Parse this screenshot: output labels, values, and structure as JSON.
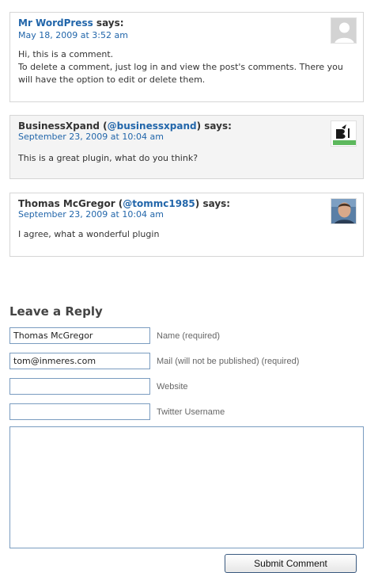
{
  "comments": [
    {
      "author": "Mr WordPress",
      "says": "says:",
      "date": "May 18, 2009 at 3:52 am",
      "body_line1": "Hi, this is a comment.",
      "body_line2": "To delete a comment, just log in and view the post's comments. There you will have the option to edit or delete them.",
      "avatar": "default-avatar-icon"
    },
    {
      "author": "BusinessXpand",
      "twitter": "@businessxpand",
      "says": "says:",
      "date": "September 23, 2009 at 10:04 am",
      "body": "This is a great plugin, what do you think?",
      "avatar": "businessxpand-logo-avatar"
    },
    {
      "author": "Thomas McGregor",
      "twitter": "@tommc1985",
      "says": "says:",
      "date": "September 23, 2009 at 10:04 am",
      "body": "I agree, what a wonderful plugin",
      "avatar": "user-photo-avatar"
    }
  ],
  "reply": {
    "title": "Leave a Reply",
    "name_value": "Thomas McGregor",
    "name_label": "Name (required)",
    "email_value": "tom@inmeres.com",
    "email_label": "Mail (will not be published) (required)",
    "website_value": "",
    "website_label": "Website",
    "twitter_value": "",
    "twitter_label": "Twitter Username",
    "comment_value": "",
    "submit_label": "Submit Comment"
  },
  "colors": {
    "link": "#2266aa",
    "text": "#333333",
    "comment_alt_bg": "#f4f4f4",
    "border": "#d6d6d6",
    "input_border": "#7a9cc0"
  }
}
